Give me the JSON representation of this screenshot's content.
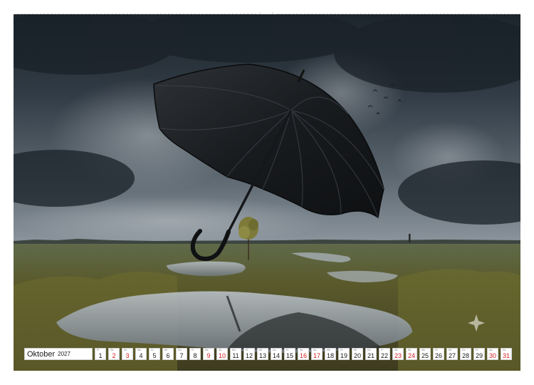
{
  "calendar": {
    "month": "Oktober",
    "year": "2027",
    "weekend_color": "#d62020",
    "days": [
      {
        "n": "1",
        "wd": "Fr",
        "we": false
      },
      {
        "n": "2",
        "wd": "Sa",
        "we": true
      },
      {
        "n": "3",
        "wd": "So",
        "we": true
      },
      {
        "n": "4",
        "wd": "Mo",
        "we": false
      },
      {
        "n": "5",
        "wd": "Di",
        "we": false
      },
      {
        "n": "6",
        "wd": "Mi",
        "we": false
      },
      {
        "n": "7",
        "wd": "Do",
        "we": false
      },
      {
        "n": "8",
        "wd": "Fr",
        "we": false
      },
      {
        "n": "9",
        "wd": "Sa",
        "we": true
      },
      {
        "n": "10",
        "wd": "So",
        "we": true
      },
      {
        "n": "11",
        "wd": "Mo",
        "we": false
      },
      {
        "n": "12",
        "wd": "Di",
        "we": false
      },
      {
        "n": "13",
        "wd": "Mi",
        "we": false
      },
      {
        "n": "14",
        "wd": "Do",
        "we": false
      },
      {
        "n": "15",
        "wd": "Fr",
        "we": false
      },
      {
        "n": "16",
        "wd": "Sa",
        "we": true
      },
      {
        "n": "17",
        "wd": "So",
        "we": true
      },
      {
        "n": "18",
        "wd": "Mo",
        "we": false
      },
      {
        "n": "19",
        "wd": "Di",
        "we": false
      },
      {
        "n": "20",
        "wd": "Mi",
        "we": false
      },
      {
        "n": "21",
        "wd": "Do",
        "we": false
      },
      {
        "n": "22",
        "wd": "Fr",
        "we": false
      },
      {
        "n": "23",
        "wd": "Sa",
        "we": true
      },
      {
        "n": "24",
        "wd": "So",
        "we": true
      },
      {
        "n": "25",
        "wd": "Mo",
        "we": false
      },
      {
        "n": "26",
        "wd": "Di",
        "we": false
      },
      {
        "n": "27",
        "wd": "Mi",
        "we": false
      },
      {
        "n": "28",
        "wd": "Do",
        "we": false
      },
      {
        "n": "29",
        "wd": "Fr",
        "we": false
      },
      {
        "n": "30",
        "wd": "Sa",
        "we": true
      },
      {
        "n": "31",
        "wd": "So",
        "we": true
      }
    ]
  },
  "photo": {
    "sky_colors": [
      "#1f2830",
      "#3a4550",
      "#7d8892"
    ],
    "umbrella_color": "#1a1d20",
    "grass_color": "#6b6a2e",
    "icons": [
      "umbrella-icon",
      "tree-icon",
      "bird-icon",
      "watermark-star-icon"
    ]
  }
}
